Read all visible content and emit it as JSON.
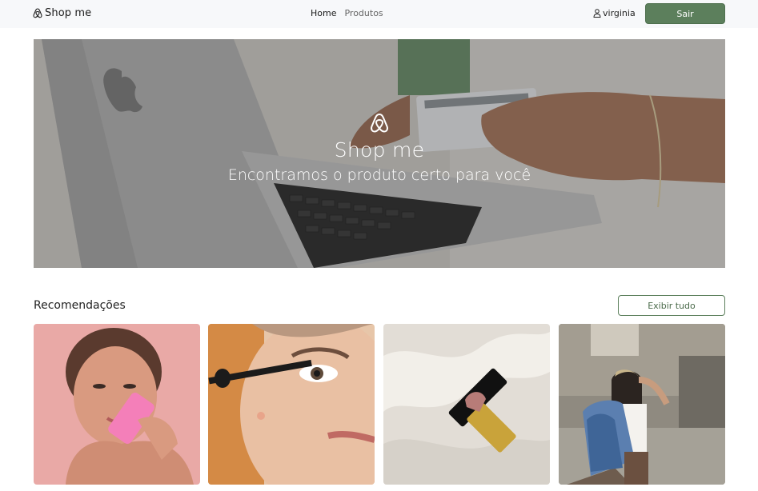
{
  "navbar": {
    "brand": "Shop me",
    "links": [
      {
        "label": "Home",
        "active": true
      },
      {
        "label": "Produtos",
        "active": false
      }
    ],
    "user": "virginia",
    "logout_label": "Sair",
    "accent_color": "#5c7f5c"
  },
  "hero": {
    "title": "Shop me",
    "subtitle": "Encontramos o produto certo para você"
  },
  "recommendations": {
    "title": "Recomendações",
    "show_all_label": "Exibir tudo",
    "products": [
      {
        "image": "woman-holding-pink-tube"
      },
      {
        "image": "mascara-application-closeup"
      },
      {
        "image": "lipstick-on-satin"
      },
      {
        "image": "woman-denim-jacket-street"
      }
    ]
  }
}
